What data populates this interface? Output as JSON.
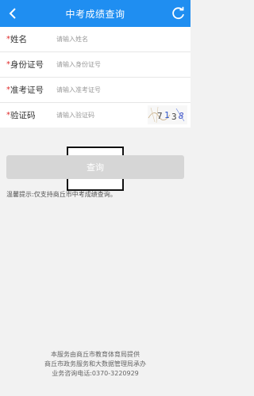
{
  "header": {
    "title": "中考成绩查询",
    "back_icon": "back-arrow-icon",
    "refresh_icon": "refresh-icon",
    "background_color": "#1f8ef1"
  },
  "form": {
    "required_mark": "*",
    "fields": [
      {
        "label": "姓名",
        "placeholder": "请输入姓名",
        "value": ""
      },
      {
        "label": "身份证号",
        "placeholder": "请输入身份证号",
        "value": ""
      },
      {
        "label": "准考证号",
        "placeholder": "请输入准考证号",
        "value": ""
      },
      {
        "label": "验证码",
        "placeholder": "请输入验证码",
        "value": ""
      }
    ],
    "captcha_text": "7138"
  },
  "actions": {
    "query_label": "查询",
    "query_color": "#d6d6d6"
  },
  "tip": "温馨提示:仅支持商丘市中考成绩查询。",
  "footer": {
    "line1": "本服务由商丘市教育体育局提供",
    "line2": "商丘市政务服务和大数据管理局承办",
    "line3": "业务咨询电话:0370-3220929"
  }
}
